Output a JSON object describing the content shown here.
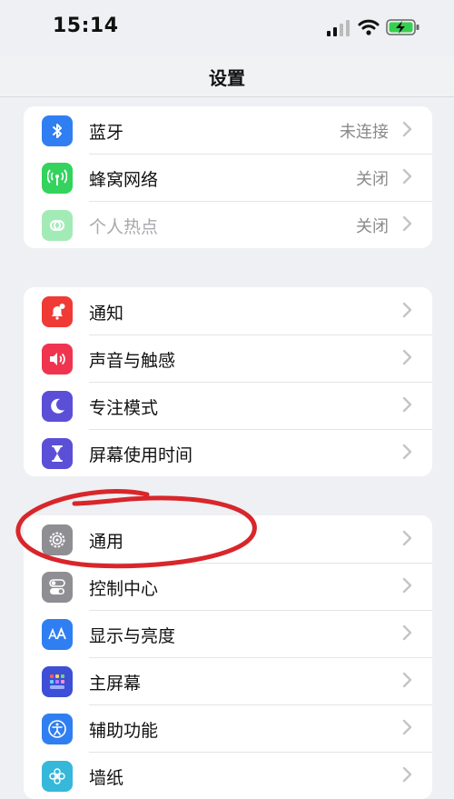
{
  "status_bar": {
    "time": "15:14"
  },
  "header": {
    "title": "设置"
  },
  "group1": [
    {
      "label": "蓝牙",
      "value": "未连接",
      "icon": "bluetooth-icon",
      "color": "#2f7ff2"
    },
    {
      "label": "蜂窝网络",
      "value": "关闭",
      "icon": "cellular-icon",
      "color": "#33d35d"
    },
    {
      "label": "个人热点",
      "value": "关闭",
      "icon": "hotspot-icon",
      "color": "#33d35d"
    }
  ],
  "group2": [
    {
      "label": "通知",
      "icon": "notification-icon",
      "color": "#f03a35"
    },
    {
      "label": "声音与触感",
      "icon": "speaker-icon",
      "color": "#f0344f"
    },
    {
      "label": "专注模式",
      "icon": "moon-icon",
      "color": "#5b4fd8"
    },
    {
      "label": "屏幕使用时间",
      "icon": "hourglass-icon",
      "color": "#5b4fd8"
    }
  ],
  "group3": [
    {
      "label": "通用",
      "icon": "gear-icon",
      "color": "#8e8e93"
    },
    {
      "label": "控制中心",
      "icon": "toggle-icon",
      "color": "#8e8e93"
    },
    {
      "label": "显示与亮度",
      "icon": "text-size-icon",
      "color": "#2f7ff2"
    },
    {
      "label": "主屏幕",
      "icon": "home-grid-icon",
      "color": "#3d4fd6"
    },
    {
      "label": "辅助功能",
      "icon": "accessibility-icon",
      "color": "#2f7ff2"
    },
    {
      "label": "墙纸",
      "icon": "wallpaper-icon",
      "color": "#35b8d9"
    }
  ],
  "annotation": {
    "color": "#d8262b"
  }
}
